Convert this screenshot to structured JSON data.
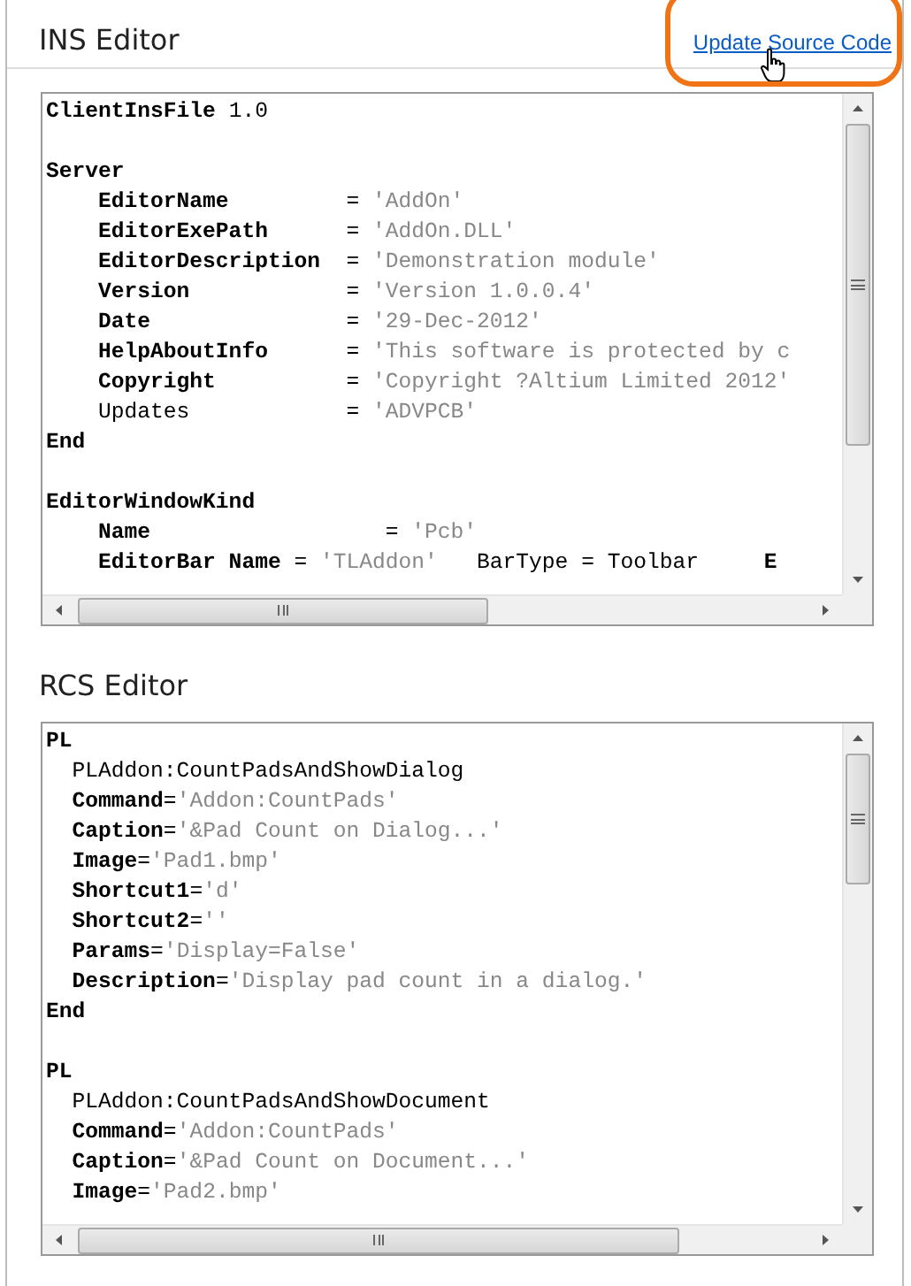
{
  "sections": [
    {
      "title": "INS Editor",
      "link": "Update Source Code",
      "lines": [
        {
          "kind": "code",
          "segments": [
            {
              "kind": "key",
              "text": "ClientInsFile"
            },
            {
              "kind": "plain",
              "text": " 1.0"
            }
          ]
        },
        {
          "kind": "blank"
        },
        {
          "kind": "code",
          "segments": [
            {
              "kind": "key",
              "text": "Server"
            }
          ]
        },
        {
          "kind": "code",
          "segments": [
            {
              "kind": "key",
              "text": "    EditorName"
            },
            {
              "kind": "plain",
              "text": "         = "
            },
            {
              "kind": "value",
              "text": "'AddOn'"
            }
          ]
        },
        {
          "kind": "code",
          "segments": [
            {
              "kind": "key",
              "text": "    EditorExePath"
            },
            {
              "kind": "plain",
              "text": "      = "
            },
            {
              "kind": "value",
              "text": "'AddOn.DLL'"
            }
          ]
        },
        {
          "kind": "code",
          "segments": [
            {
              "kind": "key",
              "text": "    EditorDescription"
            },
            {
              "kind": "plain",
              "text": "  = "
            },
            {
              "kind": "value",
              "text": "'Demonstration module'"
            }
          ]
        },
        {
          "kind": "code",
          "segments": [
            {
              "kind": "key",
              "text": "    Version"
            },
            {
              "kind": "plain",
              "text": "            = "
            },
            {
              "kind": "value",
              "text": "'Version 1.0.0.4'"
            }
          ]
        },
        {
          "kind": "code",
          "segments": [
            {
              "kind": "key",
              "text": "    Date"
            },
            {
              "kind": "plain",
              "text": "               = "
            },
            {
              "kind": "value",
              "text": "'29-Dec-2012'"
            }
          ]
        },
        {
          "kind": "code",
          "segments": [
            {
              "kind": "key",
              "text": "    HelpAboutInfo"
            },
            {
              "kind": "plain",
              "text": "      = "
            },
            {
              "kind": "value",
              "text": "'This software is protected by c"
            }
          ]
        },
        {
          "kind": "code",
          "segments": [
            {
              "kind": "key",
              "text": "    Copyright"
            },
            {
              "kind": "plain",
              "text": "          = "
            },
            {
              "kind": "value",
              "text": "'Copyright ?Altium Limited 2012'"
            }
          ]
        },
        {
          "kind": "code",
          "segments": [
            {
              "kind": "plain",
              "text": "    Updates            = "
            },
            {
              "kind": "value",
              "text": "'ADVPCB'"
            }
          ]
        },
        {
          "kind": "code",
          "segments": [
            {
              "kind": "key",
              "text": "End"
            }
          ]
        },
        {
          "kind": "blank"
        },
        {
          "kind": "code",
          "segments": [
            {
              "kind": "key",
              "text": "EditorWindowKind"
            }
          ]
        },
        {
          "kind": "code",
          "segments": [
            {
              "kind": "key",
              "text": "    Name"
            },
            {
              "kind": "plain",
              "text": "                  = "
            },
            {
              "kind": "value",
              "text": "'Pcb'"
            }
          ]
        },
        {
          "kind": "code",
          "segments": [
            {
              "kind": "key",
              "text": "    EditorBar Name"
            },
            {
              "kind": "plain",
              "text": " = "
            },
            {
              "kind": "value",
              "text": "'TLAddon'"
            },
            {
              "kind": "plain",
              "text": "   BarType = Toolbar     "
            },
            {
              "kind": "key",
              "text": "E"
            }
          ]
        }
      ]
    },
    {
      "title": "RCS Editor",
      "lines": [
        {
          "kind": "code",
          "segments": [
            {
              "kind": "key",
              "text": "PL"
            }
          ]
        },
        {
          "kind": "code",
          "segments": [
            {
              "kind": "plain",
              "text": "  PLAddon:CountPadsAndShowDialog"
            }
          ]
        },
        {
          "kind": "code",
          "segments": [
            {
              "kind": "key",
              "text": "  Command"
            },
            {
              "kind": "plain",
              "text": "="
            },
            {
              "kind": "value",
              "text": "'Addon:CountPads'"
            }
          ]
        },
        {
          "kind": "code",
          "segments": [
            {
              "kind": "key",
              "text": "  Caption"
            },
            {
              "kind": "plain",
              "text": "="
            },
            {
              "kind": "value",
              "text": "'&Pad Count on Dialog...'"
            }
          ]
        },
        {
          "kind": "code",
          "segments": [
            {
              "kind": "key",
              "text": "  Image"
            },
            {
              "kind": "plain",
              "text": "="
            },
            {
              "kind": "value",
              "text": "'Pad1.bmp'"
            }
          ]
        },
        {
          "kind": "code",
          "segments": [
            {
              "kind": "key",
              "text": "  Shortcut1"
            },
            {
              "kind": "plain",
              "text": "="
            },
            {
              "kind": "value",
              "text": "'d'"
            }
          ]
        },
        {
          "kind": "code",
          "segments": [
            {
              "kind": "key",
              "text": "  Shortcut2"
            },
            {
              "kind": "plain",
              "text": "="
            },
            {
              "kind": "value",
              "text": "''"
            }
          ]
        },
        {
          "kind": "code",
          "segments": [
            {
              "kind": "key",
              "text": "  Params"
            },
            {
              "kind": "plain",
              "text": "="
            },
            {
              "kind": "value",
              "text": "'Display=False'"
            }
          ]
        },
        {
          "kind": "code",
          "segments": [
            {
              "kind": "key",
              "text": "  Description"
            },
            {
              "kind": "plain",
              "text": "="
            },
            {
              "kind": "value",
              "text": "'Display pad count in a dialog.'"
            }
          ]
        },
        {
          "kind": "code",
          "segments": [
            {
              "kind": "key",
              "text": "End"
            }
          ]
        },
        {
          "kind": "blank"
        },
        {
          "kind": "code",
          "segments": [
            {
              "kind": "key",
              "text": "PL"
            }
          ]
        },
        {
          "kind": "code",
          "segments": [
            {
              "kind": "plain",
              "text": "  PLAddon:CountPadsAndShowDocument"
            }
          ]
        },
        {
          "kind": "code",
          "segments": [
            {
              "kind": "key",
              "text": "  Command"
            },
            {
              "kind": "plain",
              "text": "="
            },
            {
              "kind": "value",
              "text": "'Addon:CountPads'"
            }
          ]
        },
        {
          "kind": "code",
          "segments": [
            {
              "kind": "key",
              "text": "  Caption"
            },
            {
              "kind": "plain",
              "text": "="
            },
            {
              "kind": "value",
              "text": "'&Pad Count on Document...'"
            }
          ]
        },
        {
          "kind": "code",
          "segments": [
            {
              "kind": "key",
              "text": "  Image"
            },
            {
              "kind": "plain",
              "text": "="
            },
            {
              "kind": "value",
              "text": "'Pad2.bmp'"
            }
          ]
        }
      ]
    }
  ]
}
